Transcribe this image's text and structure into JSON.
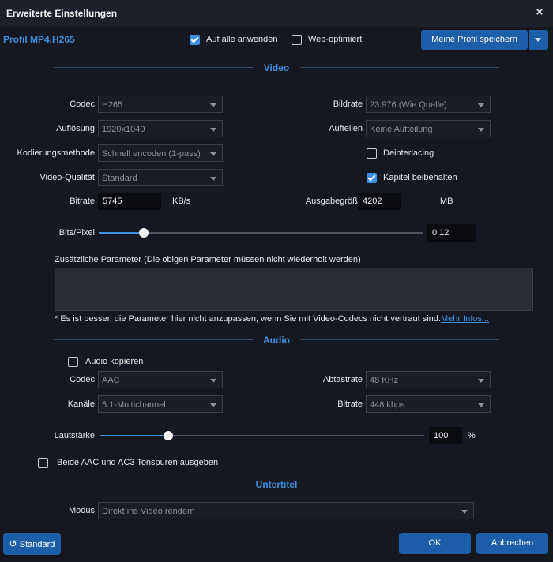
{
  "window": {
    "title": "Erweiterte Einstellungen",
    "close_icon": "×"
  },
  "header": {
    "profile": "Profil MP4.H265",
    "apply_all": {
      "label": "Auf alle anwenden",
      "checked": true
    },
    "web_optimized": {
      "label": "Web-optimiert",
      "checked": false
    },
    "save_profile_label": "Meine Profil speichern"
  },
  "video": {
    "section_title": "Video",
    "codec": {
      "label": "Codec",
      "value": "H265"
    },
    "resolution": {
      "label": "Auflösung",
      "value": "1920x1040"
    },
    "encoding": {
      "label": "Kodierungsmethode",
      "value": "Schnell encoden (1-pass)"
    },
    "quality": {
      "label": "Video-Qualität",
      "value": "Standard"
    },
    "bitrate": {
      "label": "Bitrate",
      "value": "5745",
      "unit": "KB/s"
    },
    "framerate": {
      "label": "Bildrate",
      "value": "23.976 (Wie Quelle)"
    },
    "split": {
      "label": "Aufteilen",
      "value": "Keine Aufteilung"
    },
    "deinterlacing": {
      "label": "Deinterlacing",
      "checked": false
    },
    "keep_chapters": {
      "label": "Kapitel beibehalten",
      "checked": true
    },
    "output_size": {
      "label": "Ausgabegröße",
      "value": "4202",
      "unit": "MB"
    },
    "bits_per_pixel": {
      "label": "Bits/Pixel",
      "value": "0.12",
      "fraction": 0.14
    },
    "extra_params_label": "Zusätzliche Parameter (Die obigen Parameter müssen nicht wiederholt werden)",
    "hint": "* Es ist besser, die Parameter hier nicht anzupassen, wenn Sie mit Video-Codecs nicht vertraut sind.",
    "more_info": "Mehr Infos..."
  },
  "audio": {
    "section_title": "Audio",
    "copy_audio": {
      "label": "Audio kopieren",
      "checked": false
    },
    "codec": {
      "label": "Codec",
      "value": "AAC"
    },
    "channels": {
      "label": "Kanäle",
      "value": "5.1-Multichannel"
    },
    "samplerate": {
      "label": "Abtastrate",
      "value": "48 KHz"
    },
    "bitrate": {
      "label": "Bitrate",
      "value": "448 kbps"
    },
    "volume": {
      "label": "Lautstärke",
      "value": "100",
      "unit": "%",
      "fraction": 0.21
    },
    "both_tracks": {
      "label": "Beide AAC und AC3 Tonspuren ausgeben",
      "checked": false
    }
  },
  "subtitles": {
    "section_title": "Untertitel",
    "mode": {
      "label": "Modus",
      "value": "Direkt ins Video rendern"
    }
  },
  "footer": {
    "default_label": "Standard",
    "ok_label": "OK",
    "cancel_label": "Abbrechen"
  }
}
